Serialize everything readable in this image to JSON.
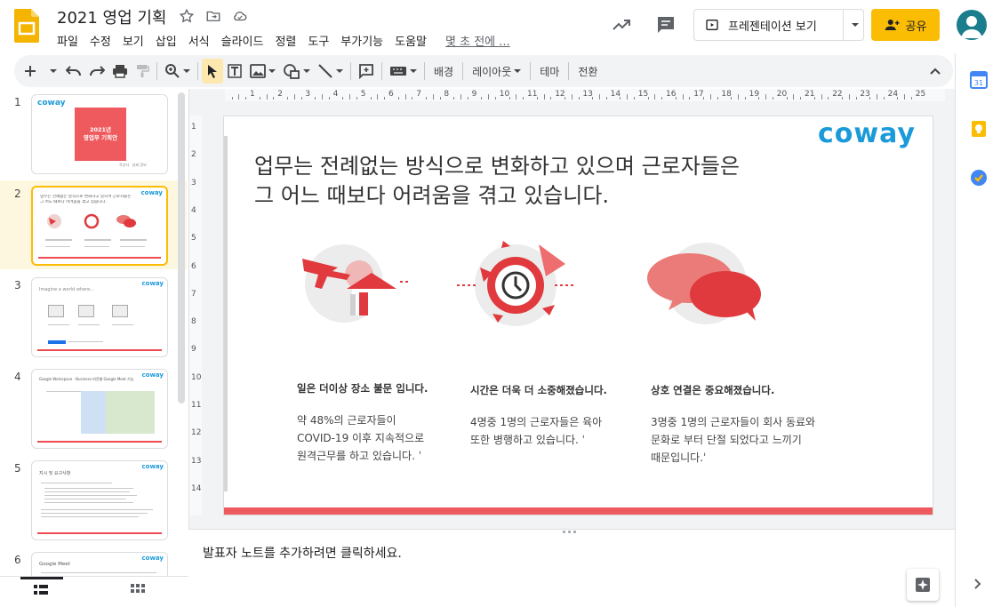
{
  "header": {
    "doc_title": "2021 영업 기획",
    "menu": [
      "파일",
      "수정",
      "보기",
      "삽입",
      "서식",
      "슬라이드",
      "정렬",
      "도구",
      "부가기능",
      "도움말"
    ],
    "last_edit": "몇 초 전에 ...",
    "present_label": "프레젠테이션 보기",
    "share_label": "공유"
  },
  "toolbar": {
    "background_label": "배경",
    "layout_label": "레이아웃",
    "theme_label": "테마",
    "transition_label": "전환"
  },
  "filmstrip": {
    "slides": [
      {
        "num": "1"
      },
      {
        "num": "2"
      },
      {
        "num": "3"
      },
      {
        "num": "4"
      },
      {
        "num": "5"
      },
      {
        "num": "6"
      }
    ],
    "thumb1_title": "2021년\n영업부 기획안",
    "thumb1_footer": "작성자 · 날짜 정보",
    "thumb3_text": "Imagine a world where...",
    "thumb4_text": "Google Workspace - Business 버전별 Google Meet 기능",
    "thumb5_text": "지시 및 요구사항",
    "thumb6_text": "Google Meet",
    "logo_text": "coway"
  },
  "slide": {
    "logo": "coway",
    "title_line1": "업무는 전례없는 방식으로 변화하고 있으며 근로자들은",
    "title_line2": "그 어느 때보다 어려움을 겪고 있습니다.",
    "columns": [
      {
        "head": "일은 더이상 장소 불문 입니다.",
        "body_lines": [
          "약 48%의 근로자들이",
          "COVID-19 이후 지속적으로",
          "원격근무를 하고 있습니다. ˈ"
        ]
      },
      {
        "head": "시간은 더욱 더 소중해졌습니다.",
        "body_lines": [
          "4명중 1명의 근로자들은 육아",
          "또한 병행하고 있습니다. ˈ"
        ]
      },
      {
        "head": "상호 연결은 중요해졌습니다.",
        "body_lines": [
          "3명중 1명의 근로자들이 회사 동료와",
          "문화로 부터 단절 되었다고 느끼기",
          "때문입니다.ˈ"
        ]
      }
    ]
  },
  "ruler": {
    "h_labels": [
      "1",
      "2",
      "3",
      "4",
      "5",
      "6",
      "7",
      "8",
      "9",
      "10",
      "11",
      "12",
      "13",
      "14",
      "15",
      "16",
      "17",
      "18",
      "19",
      "20",
      "21",
      "22",
      "23",
      "24",
      "25"
    ],
    "v_labels": [
      "1",
      "2",
      "3",
      "4",
      "5",
      "6",
      "7",
      "8",
      "9",
      "10",
      "11",
      "12",
      "13",
      "14"
    ]
  },
  "notes": {
    "placeholder": "발표자 노트를 추가하려면 클릭하세요."
  },
  "colors": {
    "accent_yellow": "#fbbc04",
    "coway_blue": "#1b9ad9",
    "slide_red": "#ef5a5f"
  }
}
